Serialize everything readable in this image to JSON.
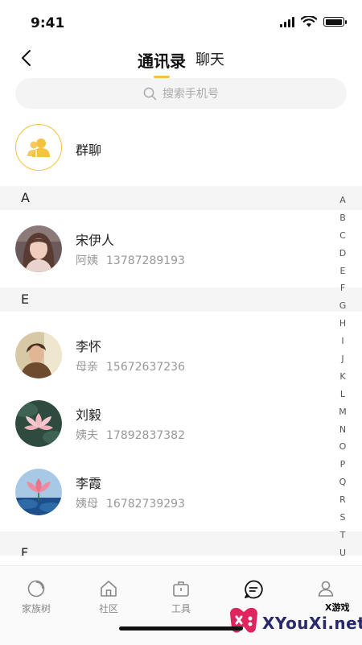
{
  "status_bar": {
    "time": "9:41"
  },
  "nav": {
    "tabs": [
      {
        "label": "通讯录",
        "active": true
      },
      {
        "label": "聊天",
        "active": false
      }
    ]
  },
  "search": {
    "placeholder": "搜索手机号"
  },
  "group": {
    "label": "群聊"
  },
  "sections": [
    {
      "letter": "A",
      "contacts": [
        {
          "name": "宋伊人",
          "relation": "阿姨",
          "phone": "13787289193"
        }
      ]
    },
    {
      "letter": "E",
      "contacts": [
        {
          "name": "李怀",
          "relation": "母亲",
          "phone": "15672637236"
        },
        {
          "name": "刘毅",
          "relation": "姨夫",
          "phone": "17892837382"
        },
        {
          "name": "李霞",
          "relation": "姨母",
          "phone": "16782739293"
        }
      ]
    },
    {
      "letter": "F",
      "contacts": []
    }
  ],
  "index_letters": [
    "A",
    "B",
    "C",
    "D",
    "E",
    "F",
    "G",
    "H",
    "I",
    "J",
    "K",
    "L",
    "M",
    "N",
    "O",
    "P",
    "Q",
    "R",
    "S",
    "T",
    "U"
  ],
  "tabbar": {
    "items": [
      {
        "label": "家族树",
        "icon": "circle-icon"
      },
      {
        "label": "社区",
        "icon": "home-icon"
      },
      {
        "label": "工具",
        "icon": "toolbox-icon"
      },
      {
        "label": "",
        "icon": "chat-icon",
        "active": true
      },
      {
        "label": "",
        "icon": "user-icon"
      }
    ]
  },
  "watermark": {
    "small": "X游戏",
    "main": "XYouXi.net"
  },
  "colors": {
    "accent": "#F5C242",
    "section_bg": "#F5F5F5",
    "search_bg": "#F4F4F4",
    "meta_text": "#999999"
  }
}
